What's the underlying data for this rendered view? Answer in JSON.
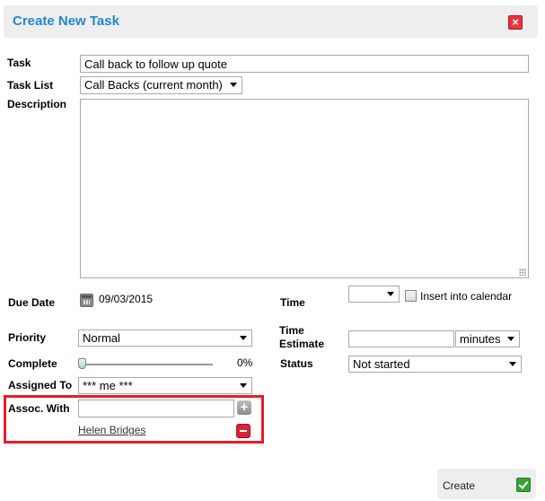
{
  "dialog": {
    "title": "Create New Task",
    "close_icon": "close-icon"
  },
  "labels": {
    "task": "Task",
    "task_list": "Task List",
    "description": "Description",
    "due_date": "Due Date",
    "time": "Time",
    "priority": "Priority",
    "time_estimate_line1": "Time",
    "time_estimate_line2": "Estimate",
    "complete": "Complete",
    "status": "Status",
    "assigned_to": "Assigned To",
    "assoc_with": "Assoc. With"
  },
  "fields": {
    "task_value": "Call back to follow up quote",
    "task_list_value": "Call Backs (current month)",
    "description_value": "",
    "due_date_value": "09/03/2015",
    "time_value": "",
    "insert_into_calendar_label": "Insert into calendar",
    "insert_into_calendar_checked": false,
    "priority_value": "Normal",
    "time_estimate_value": "",
    "time_estimate_unit": "minutes",
    "complete_percent_label": "0%",
    "complete_fraction": 0,
    "status_value": "Not started",
    "assigned_to_value": "*** me ***",
    "assoc_with_value": "",
    "assoc_contact": "Helen Bridges"
  },
  "actions": {
    "create_label": "Create"
  },
  "colors": {
    "title": "#2389c9",
    "highlight_box": "#e0202a",
    "close_button": "#e8353f",
    "create_check": "#39a13c"
  }
}
